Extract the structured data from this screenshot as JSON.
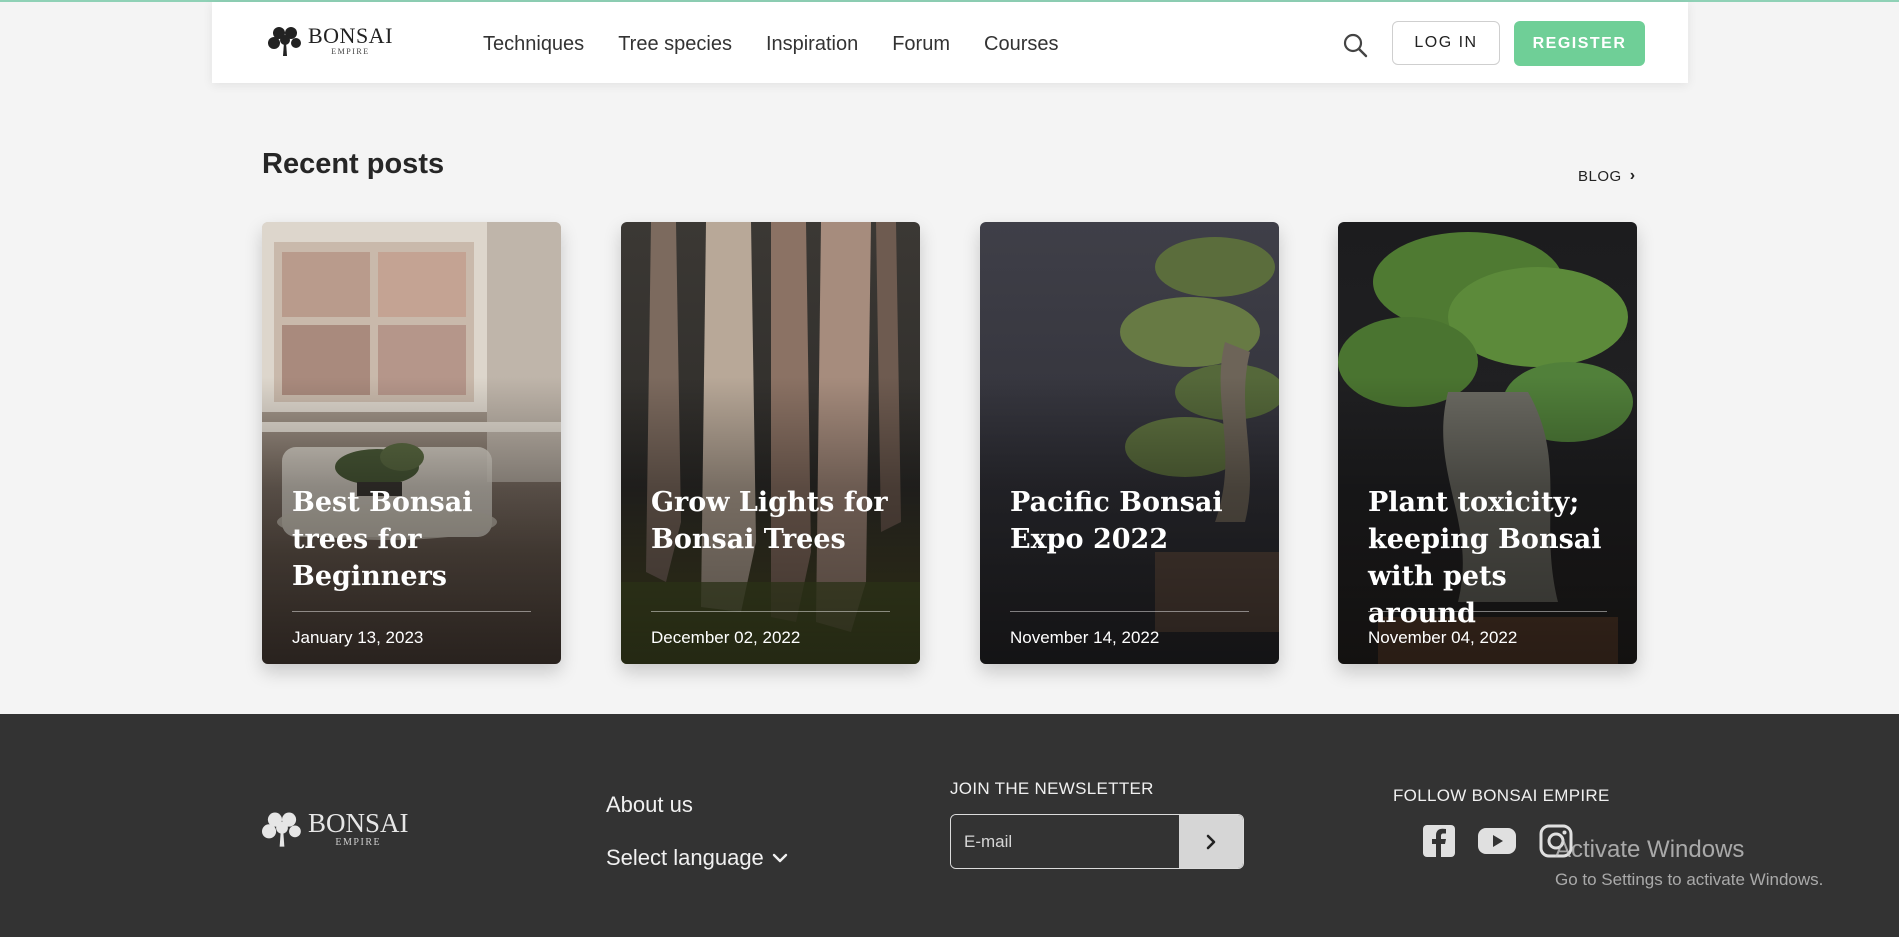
{
  "header": {
    "logo": {
      "name": "BONSAI",
      "sub": "EMPIRE"
    },
    "nav": [
      "Techniques",
      "Tree species",
      "Inspiration",
      "Forum",
      "Courses"
    ],
    "login_label": "LOG IN",
    "register_label": "REGISTER"
  },
  "recent": {
    "title": "Recent posts",
    "blog_link": "BLOG",
    "posts": [
      {
        "title": "Best Bonsai trees for Beginners",
        "date": "January 13, 2023"
      },
      {
        "title": "Grow Lights for Bonsai Trees",
        "date": "December 02, 2022"
      },
      {
        "title": "Pacific Bonsai Expo 2022",
        "date": "November 14, 2022"
      },
      {
        "title": "Plant toxicity; keeping Bonsai with pets around",
        "date": "November 04, 2022"
      }
    ]
  },
  "footer": {
    "logo": {
      "name": "BONSAI",
      "sub": "EMPIRE"
    },
    "about": "About us",
    "language": "Select language",
    "newsletter_label": "JOIN THE NEWSLETTER",
    "email_placeholder": "E-mail",
    "follow_label": "FOLLOW BONSAI EMPIRE",
    "social": [
      "facebook-icon",
      "youtube-icon",
      "instagram-icon"
    ]
  },
  "watermark": {
    "line1": "Activate Windows",
    "line2": "Go to Settings to activate Windows."
  },
  "colors": {
    "accent": "#6fcf97",
    "footer_bg": "#333333",
    "page_bg": "#f4f4f4"
  }
}
